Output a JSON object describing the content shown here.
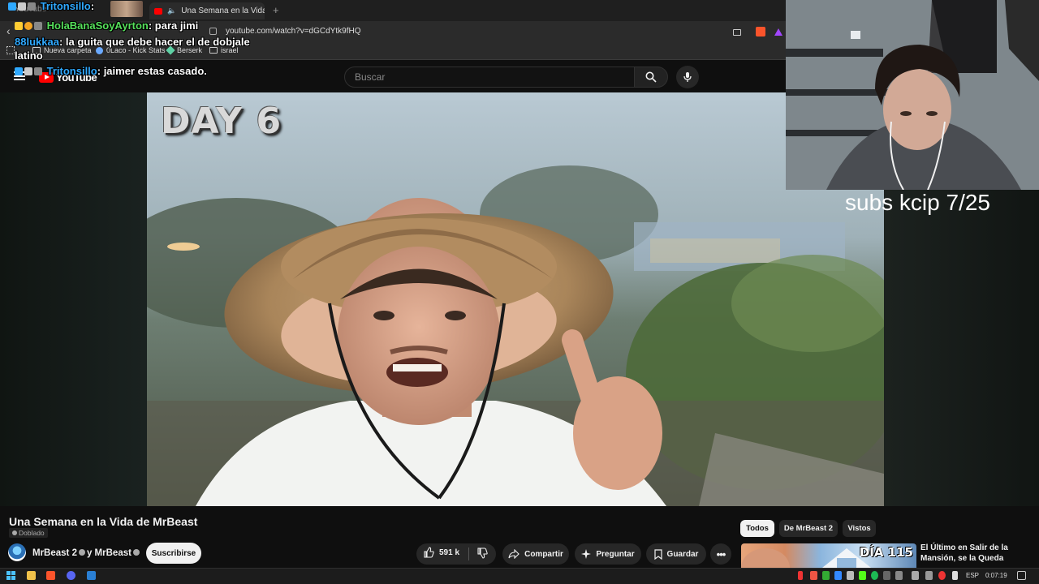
{
  "browser": {
    "tab_ghost": "YouTube",
    "tab_title": "Una Semana en la Vida de M",
    "url": "youtube.com/watch?v=dGCdYtk9fHQ",
    "bookmarks": [
      "Nueva carpeta",
      "0Laco - Kick Stats",
      "Berserk",
      "israel"
    ]
  },
  "youtube": {
    "logo": "YouTube",
    "search_placeholder": "Buscar"
  },
  "chat": [
    {
      "user": "Tritonsillo",
      "message": "",
      "user_color": "#2fa9ff"
    },
    {
      "user": "HolaBanaSoyAyrton",
      "message": ": para jimi",
      "user_color": "#56e05b"
    },
    {
      "user": "88lukkaa",
      "message": ": la guita que debe hacer el de dobjale",
      "user_color": "#2fa9ff"
    },
    {
      "user": "",
      "message": "latino",
      "user_color": "#ffffff"
    },
    {
      "user": "Tritonsillo",
      "message": ": jaimer estas casado.",
      "user_color": "#2fa9ff"
    }
  ],
  "video": {
    "overlay_text": "DAY 6"
  },
  "stream_overlay": {
    "subs_text": "subs kcip 7/25"
  },
  "watch": {
    "title": "Una Semana en la Vida de MrBeast",
    "dub_label": "Doblado",
    "channel": "MrBeast 2 ✓ y MrBeast",
    "channel_a": "MrBeast 2",
    "channel_b": "y MrBeast",
    "subscribe": "Suscribirse",
    "likes": "591 k",
    "share": "Compartir",
    "ask": "Preguntar",
    "save": "Guardar"
  },
  "chips": [
    "Todos",
    "De MrBeast 2",
    "Vistos"
  ],
  "recommendation": {
    "badge": "DÍA 115",
    "title": "El Último en Salir de la Mansión, se la Queda"
  },
  "taskbar": {
    "language": "ESP",
    "time": "0:07:19"
  },
  "colors": {
    "youtube_red": "#ff0000",
    "chat_blue": "#2fa9ff",
    "chat_green": "#56e05b",
    "background": "#0f0f0f"
  }
}
